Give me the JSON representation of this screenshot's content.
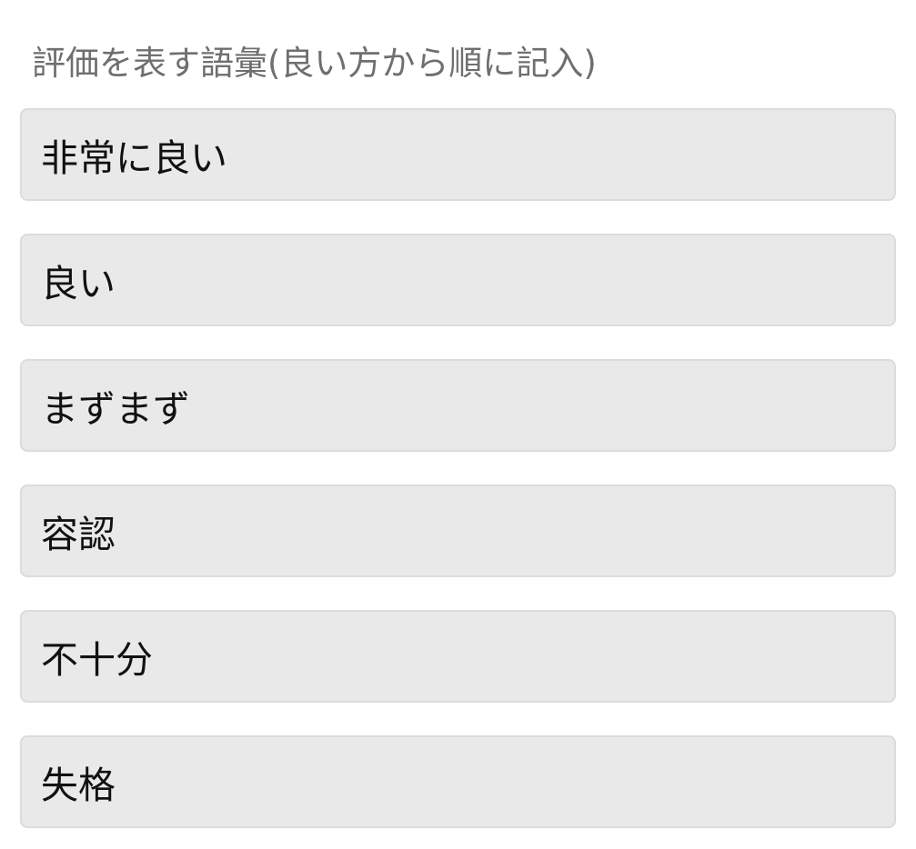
{
  "rating_scale": {
    "label": "評価を表す語彙(良い方から順に記入)",
    "levels": [
      {
        "value": "非常に良い"
      },
      {
        "value": "良い"
      },
      {
        "value": "まずまず"
      },
      {
        "value": "容認"
      },
      {
        "value": "不十分"
      },
      {
        "value": "失格"
      }
    ]
  }
}
